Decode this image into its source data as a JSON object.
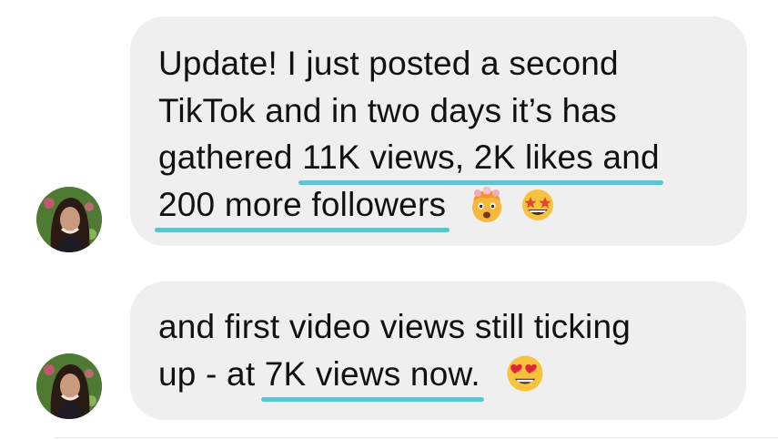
{
  "messages": [
    {
      "line1": "Update! I just posted a second",
      "line2": "TikTok and in two days it’s has",
      "line3_pre": "gathered ",
      "line3_hl": "11K views, 2K likes and",
      "line4_hl": "200 more followers",
      "emojis": [
        "exploding-head-emoji",
        "star-struck-emoji"
      ]
    },
    {
      "line1": "and first video views still ticking",
      "line2_pre": "up - at ",
      "line2_hl": "7K views now.",
      "emojis": [
        "heart-eyes-emoji"
      ]
    }
  ],
  "colors": {
    "bubble": "#efefef",
    "highlight": "#5fc4cf",
    "text": "#111111"
  }
}
